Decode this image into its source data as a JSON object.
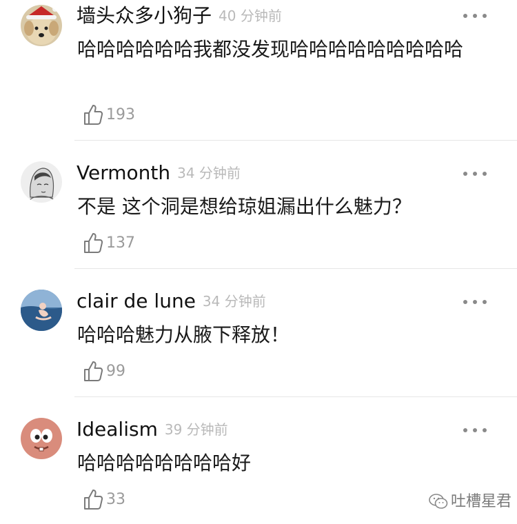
{
  "comments": [
    {
      "username": "墙头众多小狗子",
      "time": "40 分钟前",
      "text": "哈哈哈哈哈哈我都没发现哈哈哈哈哈哈哈哈哈",
      "likes": "193",
      "avatar": "golden-retriever-santa-hat"
    },
    {
      "username": "Vermonth",
      "time": "34 分钟前",
      "text": "不是 这个洞是想给琼姐漏出什么魅力？",
      "likes": "137",
      "avatar": "anime-sketch-portrait"
    },
    {
      "username": "clair de lune",
      "time": "34 分钟前",
      "text": "哈哈哈魅力从腋下释放！",
      "likes": "99",
      "avatar": "figure-in-blue-water"
    },
    {
      "username": "Idealism",
      "time": "39 分钟前",
      "text": "哈哈哈哈哈哈哈哈好",
      "likes": "33",
      "avatar": "pink-cartoon-face"
    }
  ],
  "watermark": {
    "label": "吐槽星君",
    "icon": "wechat-icon"
  },
  "colors": {
    "username": "#111111",
    "timestamp": "#b9b9b9",
    "text": "#1a1a1a",
    "like_count": "#9a9a9a",
    "divider": "#e6e6e6"
  }
}
